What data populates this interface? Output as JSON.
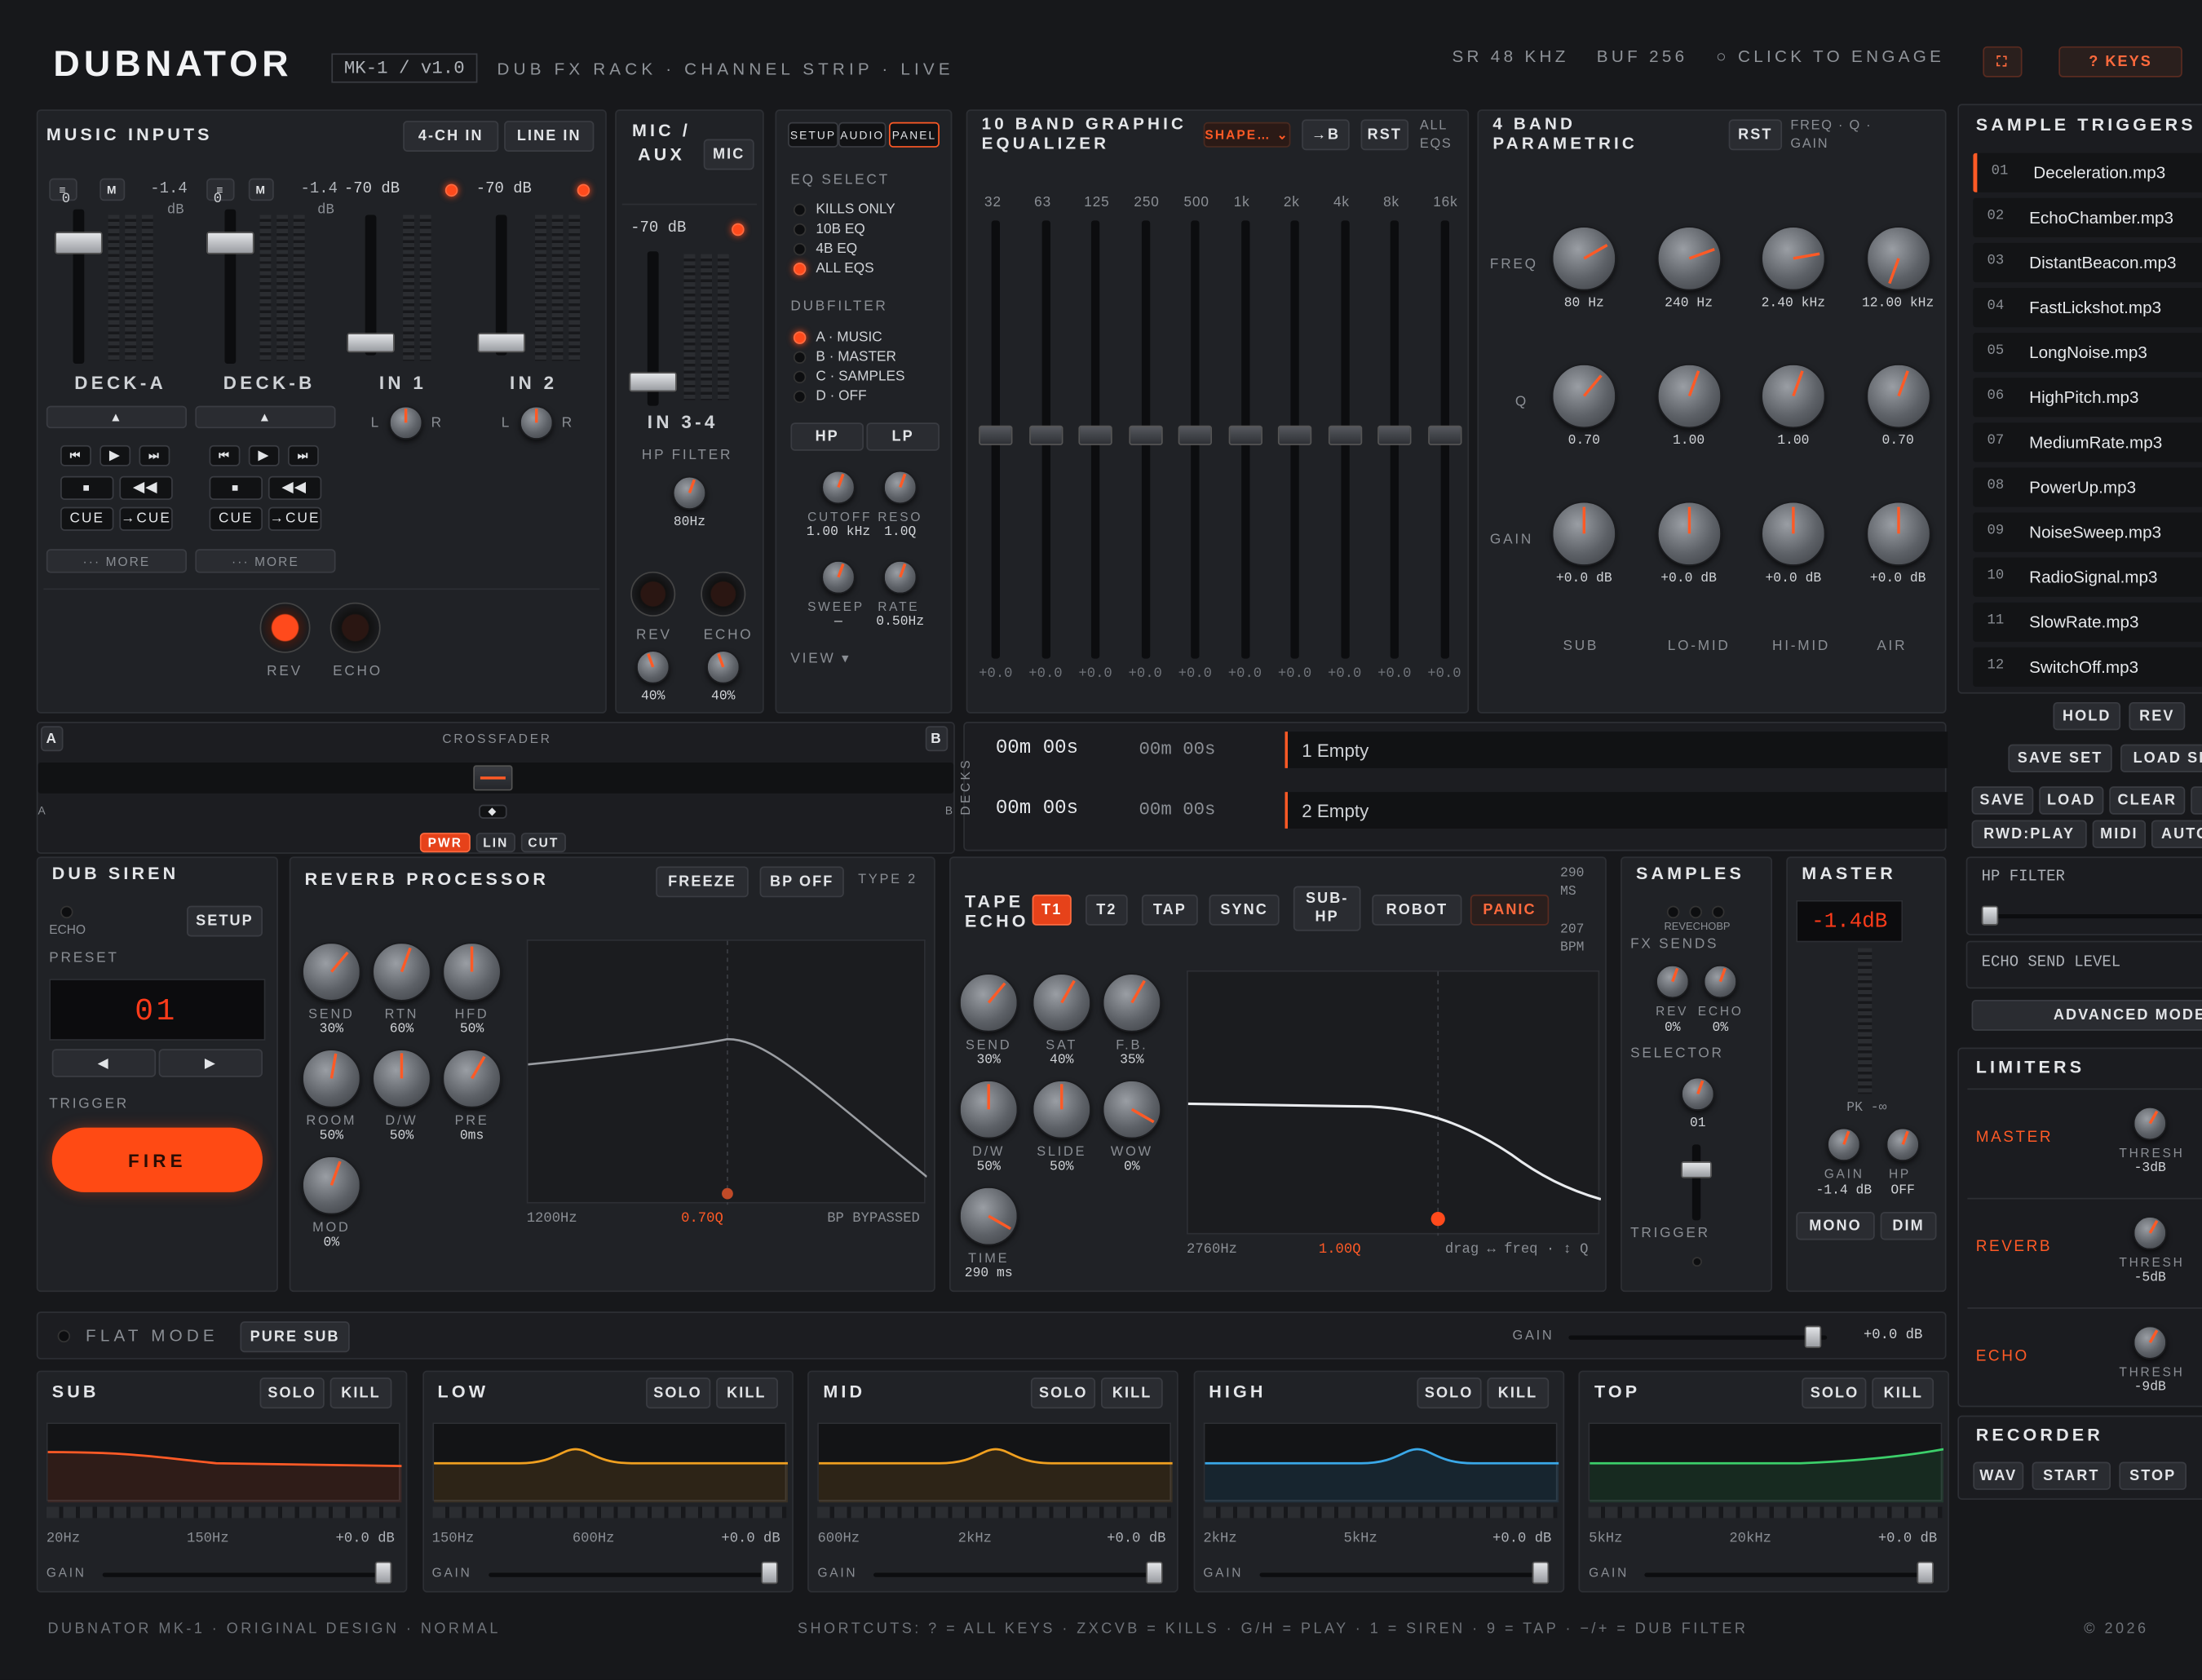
{
  "header": {
    "logo": "DUBNATOR",
    "version": "MK-1 / v1.0",
    "subtitle": "DUB FX RACK · CHANNEL STRIP · LIVE",
    "sr": "SR 48 KHZ",
    "buf": "BUF 256",
    "engage": "○ CLICK TO ENGAGE",
    "keys": "? KEYS",
    "accent": "#ff4a1c"
  },
  "music_inputs": {
    "title": "MUSIC INPUTS",
    "btn_4ch": "4-CH IN",
    "btn_line": "LINE IN",
    "decks": [
      {
        "name": "DECK-A",
        "db": "-1.4",
        "unit": "dB",
        "zero": "0",
        "more": "··· MORE",
        "cue": "CUE",
        "tocue": "→CUE"
      },
      {
        "name": "DECK-B",
        "db": "-1.4",
        "unit": "dB",
        "zero": "0",
        "more": "··· MORE",
        "cue": "CUE",
        "tocue": "→CUE"
      }
    ],
    "ins": [
      {
        "name": "IN 1",
        "db": "-70 dB",
        "l": "L",
        "r": "R"
      },
      {
        "name": "IN 2",
        "db": "-70 dB",
        "l": "L",
        "r": "R"
      }
    ],
    "rev": "REV",
    "echo": "ECHO"
  },
  "mic": {
    "title": "MIC / AUX",
    "btn": "MIC",
    "db": "-70 dB",
    "name": "IN 3-4",
    "hp": "HP FILTER",
    "hpv": "80Hz",
    "rev": "REV",
    "echo": "ECHO",
    "revv": "40%",
    "echov": "40%"
  },
  "eqsel": {
    "tabs": [
      "SETUP",
      "AUDIO",
      "PANEL"
    ],
    "title": "EQ SELECT",
    "opts": [
      "KILLS ONLY",
      "10B EQ",
      "4B EQ",
      "ALL EQS"
    ],
    "df": "DUBFILTER",
    "dfopts": [
      "A · MUSIC",
      "B · MASTER",
      "C · SAMPLES",
      "D · OFF"
    ],
    "hp": "HP",
    "lp": "LP",
    "cutoff": "CUTOFF",
    "reso": "RESO",
    "cutv": "1.00 kHz",
    "resv": "1.0Q",
    "sweep": "SWEEP",
    "rate": "RATE",
    "sweepv": "—",
    "ratev": "0.50Hz",
    "view": "VIEW ▾"
  },
  "geq": {
    "title": "10 BAND GRAPHIC EQUALIZER",
    "shape": "SHAPE…",
    "tob": "→B",
    "rst": "RST",
    "all": "ALL EQS",
    "bands": [
      "32",
      "63",
      "125",
      "250",
      "500",
      "1k",
      "2k",
      "4k",
      "8k",
      "16k"
    ],
    "val": "+0.0"
  },
  "peq": {
    "title": "4 BAND PARAMETRIC",
    "rst": "RST",
    "info": "FREQ · Q · GAIN",
    "rows": [
      "FREQ",
      "Q",
      "GAIN"
    ],
    "freq": [
      "80 Hz",
      "240 Hz",
      "2.40 kHz",
      "12.00 kHz"
    ],
    "q": [
      "0.70",
      "1.00",
      "1.00",
      "0.70"
    ],
    "gain": [
      "+0.0 dB",
      "+0.0 dB",
      "+0.0 dB",
      "+0.0 dB"
    ],
    "bands": [
      "SUB",
      "LO-MID",
      "HI-MID",
      "AIR"
    ]
  },
  "triggers": {
    "title": "SAMPLE TRIGGERS",
    "items": [
      [
        "01",
        "Deceleration.mp3"
      ],
      [
        "02",
        "EchoChamber.mp3"
      ],
      [
        "03",
        "DistantBeacon.mp3"
      ],
      [
        "04",
        "FastLickshot.mp3"
      ],
      [
        "05",
        "LongNoise.mp3"
      ],
      [
        "06",
        "HighPitch.mp3"
      ],
      [
        "07",
        "MediumRate.mp3"
      ],
      [
        "08",
        "PowerUp.mp3"
      ],
      [
        "09",
        "NoiseSweep.mp3"
      ],
      [
        "10",
        "RadioSignal.mp3"
      ],
      [
        "11",
        "SlowRate.mp3"
      ],
      [
        "12",
        "SwitchOff.mp3"
      ]
    ],
    "hold": "HOLD",
    "rev": "REV",
    "saveset": "SAVE SET",
    "loadset": "LOAD SE",
    "save": "SAVE",
    "load": "LOAD",
    "clear": "CLEAR",
    "rwd": "RWD:PLAY",
    "midi": "MIDI",
    "auto": "AUTO",
    "hpf": "HP FILTER",
    "echo_send": "ECHO SEND LEVEL",
    "adv": "ADVANCED MODE"
  },
  "crossfader": {
    "title": "CROSSFADER",
    "a": "A",
    "b": "B",
    "pwr": "PWR",
    "lin": "LIN",
    "cut": "CUT"
  },
  "decks": {
    "label": "DECKS",
    "rows": [
      {
        "t1": "00m 00s",
        "t2": "00m 00s",
        "name": "1 Empty"
      },
      {
        "t1": "00m 00s",
        "t2": "00m 00s",
        "name": "2 Empty"
      }
    ]
  },
  "siren": {
    "title": "DUB SIREN",
    "echo": "ECHO",
    "setup": "SETUP",
    "preset": "PRESET",
    "num": "01",
    "trigger": "TRIGGER",
    "fire": "FIRE"
  },
  "reverb": {
    "title": "REVERB PROCESSOR",
    "freeze": "FREEZE",
    "bp": "BP OFF",
    "type": "TYPE 2",
    "knobs": [
      [
        "SEND",
        "30%"
      ],
      [
        "RTN",
        "60%"
      ],
      [
        "HFD",
        "50%"
      ],
      [
        "ROOM",
        "50%"
      ],
      [
        "D/W",
        "50%"
      ],
      [
        "PRE",
        "0ms"
      ],
      [
        "MOD",
        "0%"
      ]
    ],
    "f": "1200Hz",
    "q": "0.70Q",
    "st": "BP BYPASSED"
  },
  "tape": {
    "title": "TAPE ECHO",
    "t1": "T1",
    "t2": "T2",
    "tap": "TAP",
    "sync": "SYNC",
    "subhp": "SUB-HP",
    "robot": "ROBOT",
    "panic": "PANIC",
    "ms": "290 MS",
    "bpm": "207 BPM",
    "knobs": [
      [
        "SEND",
        "30%"
      ],
      [
        "SAT",
        "40%"
      ],
      [
        "F.B.",
        "35%"
      ],
      [
        "D/W",
        "50%"
      ],
      [
        "SLIDE",
        "50%"
      ],
      [
        "WOW",
        "0%"
      ],
      [
        "TIME",
        "290 ms"
      ]
    ],
    "f": "2760Hz",
    "q": "1.00Q",
    "hint": "drag ↔ freq · ↕ Q"
  },
  "samples": {
    "title": "SAMPLES",
    "rh": "REVECHOBP",
    "fx": "FX SENDS",
    "rev": "REV",
    "echo": "ECHO",
    "rv": "0%",
    "ev": "0%",
    "sel": "SELECTOR",
    "selv": "01",
    "trig": "TRIGGER"
  },
  "master": {
    "title": "MASTER",
    "db": "-1.4dB",
    "pk": "PK -∞",
    "gain": "GAIN",
    "hp": "HP",
    "gv": "-1.4 dB",
    "hv": "OFF",
    "mono": "MONO",
    "dim": "DIM"
  },
  "limiters": {
    "title": "LIMITERS",
    "items": [
      [
        "MASTER",
        "THRESH",
        "-3dB"
      ],
      [
        "REVERB",
        "THRESH",
        "-5dB"
      ],
      [
        "ECHO",
        "THRESH",
        "-9dB"
      ]
    ]
  },
  "recorder": {
    "title": "RECORDER",
    "wav": "WAV",
    "start": "START",
    "stop": "STOP"
  },
  "flat": {
    "label": "FLAT MODE",
    "btn": "PURE SUB",
    "gain": "GAIN",
    "val": "+0.0 dB"
  },
  "bands": [
    {
      "name": "SUB",
      "f1": "20Hz",
      "f2": "150Hz",
      "v": "+0.0 dB",
      "color": "#ff5a26"
    },
    {
      "name": "LOW",
      "f1": "150Hz",
      "f2": "600Hz",
      "v": "+0.0 dB",
      "color": "#f0a020"
    },
    {
      "name": "MID",
      "f1": "600Hz",
      "f2": "2kHz",
      "v": "+0.0 dB",
      "color": "#f0a020"
    },
    {
      "name": "HIGH",
      "f1": "2kHz",
      "f2": "5kHz",
      "v": "+0.0 dB",
      "color": "#3aa8e8"
    },
    {
      "name": "TOP",
      "f1": "5kHz",
      "f2": "20kHz",
      "v": "+0.0 dB",
      "color": "#3ccf6a"
    }
  ],
  "band_btns": {
    "solo": "SOLO",
    "kill": "KILL",
    "gain": "GAIN"
  },
  "footer": {
    "left": "DUBNATOR MK-1 · ORIGINAL DESIGN · NORMAL",
    "mid": "SHORTCUTS: ? = ALL KEYS · ZXCVB = KILLS · G/H = PLAY · 1 = SIREN · 9 = TAP · −/+ = DUB FILTER",
    "right": "© 2026"
  }
}
